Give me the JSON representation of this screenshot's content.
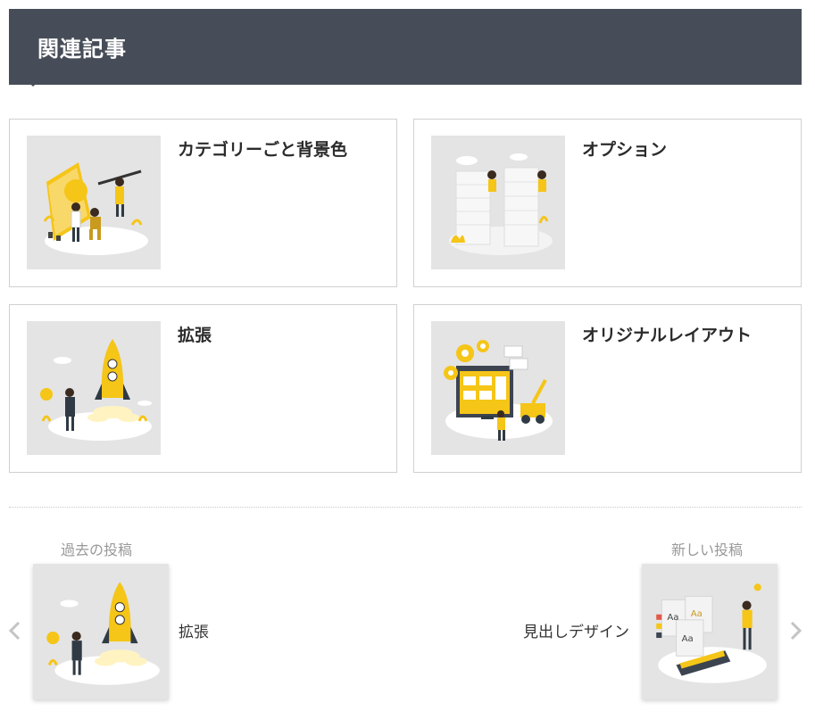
{
  "related": {
    "heading": "関連記事",
    "cards": [
      {
        "title": "カテゴリーごと背景色",
        "icon": "team-painting-illustration"
      },
      {
        "title": "オプション",
        "icon": "people-peeking-walls-illustration"
      },
      {
        "title": "拡張",
        "icon": "rocket-launch-illustration"
      },
      {
        "title": "オリジナルレイアウト",
        "icon": "website-construction-illustration"
      }
    ]
  },
  "post_nav": {
    "prev": {
      "label": "過去の投稿",
      "title": "拡張",
      "icon": "rocket-launch-illustration"
    },
    "next": {
      "label": "新しい投稿",
      "title": "見出しデザイン",
      "icon": "color-swatch-illustration"
    }
  },
  "colors": {
    "header_bg": "#474d58",
    "accent": "#f5c518",
    "thumb_bg": "#e4e4e5"
  }
}
